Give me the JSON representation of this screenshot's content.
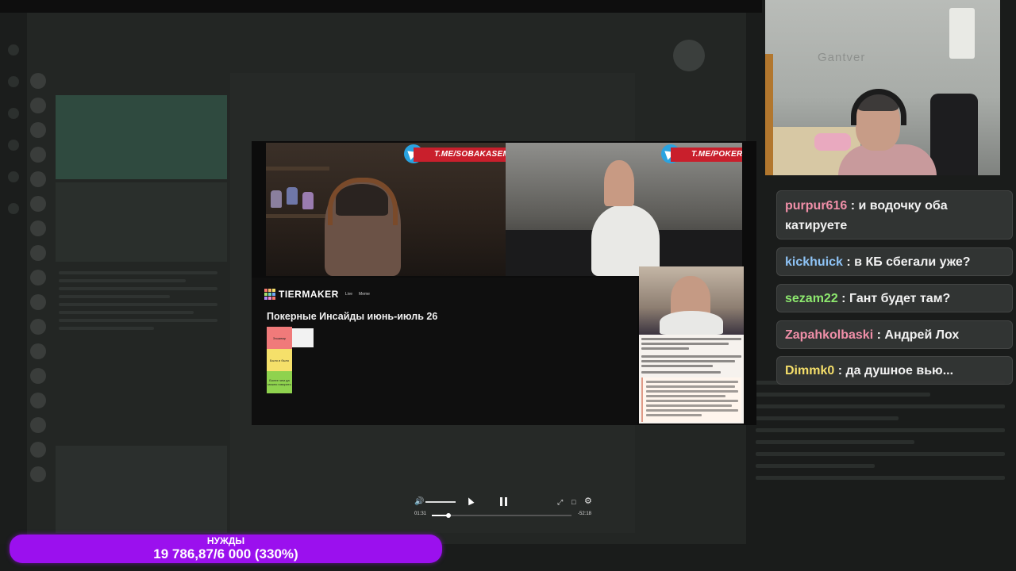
{
  "stream": {
    "watermarks": {
      "left": "T.ME/SOBAKASEMINA",
      "right": "T.ME/POKERINSIDE"
    }
  },
  "tiermaker": {
    "logo": "TIERMAKER",
    "nav": [
      "Live",
      "Meme"
    ],
    "title": "Покерные Инсайды июнь-июль 26",
    "tiers": [
      {
        "label": "Зашквар",
        "color": "#f07a7a"
      },
      {
        "label": "Было и было",
        "color": "#f5e06a"
      },
      {
        "label": "Более чем да можно говорить",
        "color": "#8fd24e"
      }
    ]
  },
  "player": {
    "time_current": "01:31",
    "time_remaining": "-52:18",
    "progress_fraction": 0.12,
    "volume_fraction": 0.95
  },
  "webcam": {
    "wall_logo": "Gantver"
  },
  "chat": {
    "messages": [
      {
        "user": "purpur616",
        "text": "и водочку оба катируете",
        "color": "#f08fa8"
      },
      {
        "user": "kickhuick",
        "text": "в КБ сбегали уже?",
        "color": "#8ec3f5"
      },
      {
        "user": "sezam22",
        "text": "Гант будет там?",
        "color": "#8de86e"
      },
      {
        "user": "Zapahkolbaski",
        "text": "Андрей Лох",
        "color": "#f08fa8"
      },
      {
        "user": "Dimmk0",
        "text": "да душное вью...",
        "color": "#f5df6a"
      }
    ]
  },
  "goal": {
    "label": "НУЖДЫ",
    "value": "19 786,87/6 000 (330%)"
  },
  "colors": {
    "goal_bar": "#9b10ee",
    "telegram_red": "#c91f2c",
    "telegram_blue": "#2aa3e0"
  }
}
